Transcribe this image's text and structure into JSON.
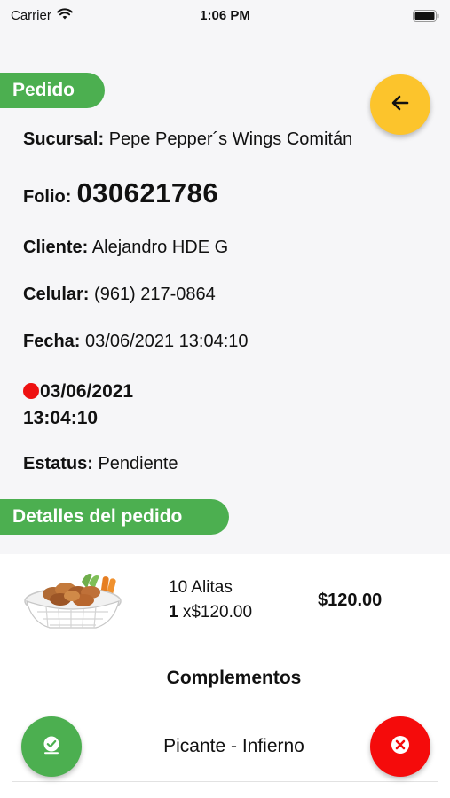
{
  "status_bar": {
    "carrier": "Carrier",
    "time": "1:06 PM"
  },
  "sections": {
    "pedido": "Pedido",
    "detalles": "Detalles del pedido"
  },
  "order": {
    "sucursal_label": "Sucursal:",
    "sucursal_value": "Pepe Pepper´s Wings Comitán",
    "folio_label": "Folio:",
    "folio_value": "030621786",
    "cliente_label": "Cliente:",
    "cliente_value": "Alejandro HDE G",
    "celular_label": "Celular:",
    "celular_value": "(961) 217-0864",
    "fecha_label": "Fecha:",
    "fecha_value": "03/06/2021 13:04:10",
    "highlight_date": "03/06/2021",
    "highlight_time": "13:04:10",
    "estatus_label": "Estatus:",
    "estatus_value": "Pendiente"
  },
  "detail": {
    "name": "10 Alitas",
    "qty": "1",
    "unit_price": "x$120.00",
    "total": "$120.00"
  },
  "complements": {
    "title": "Complementos",
    "items": [
      "Picante - Infierno"
    ]
  },
  "icons": {
    "back": "arrow-left-icon",
    "accept": "check-accept-icon",
    "cancel": "close-circle-icon"
  },
  "colors": {
    "accent_green": "#4caf50",
    "back_yellow": "#fcc42c",
    "cancel_red": "#f50b0b",
    "status_dot": "#ee1111"
  }
}
